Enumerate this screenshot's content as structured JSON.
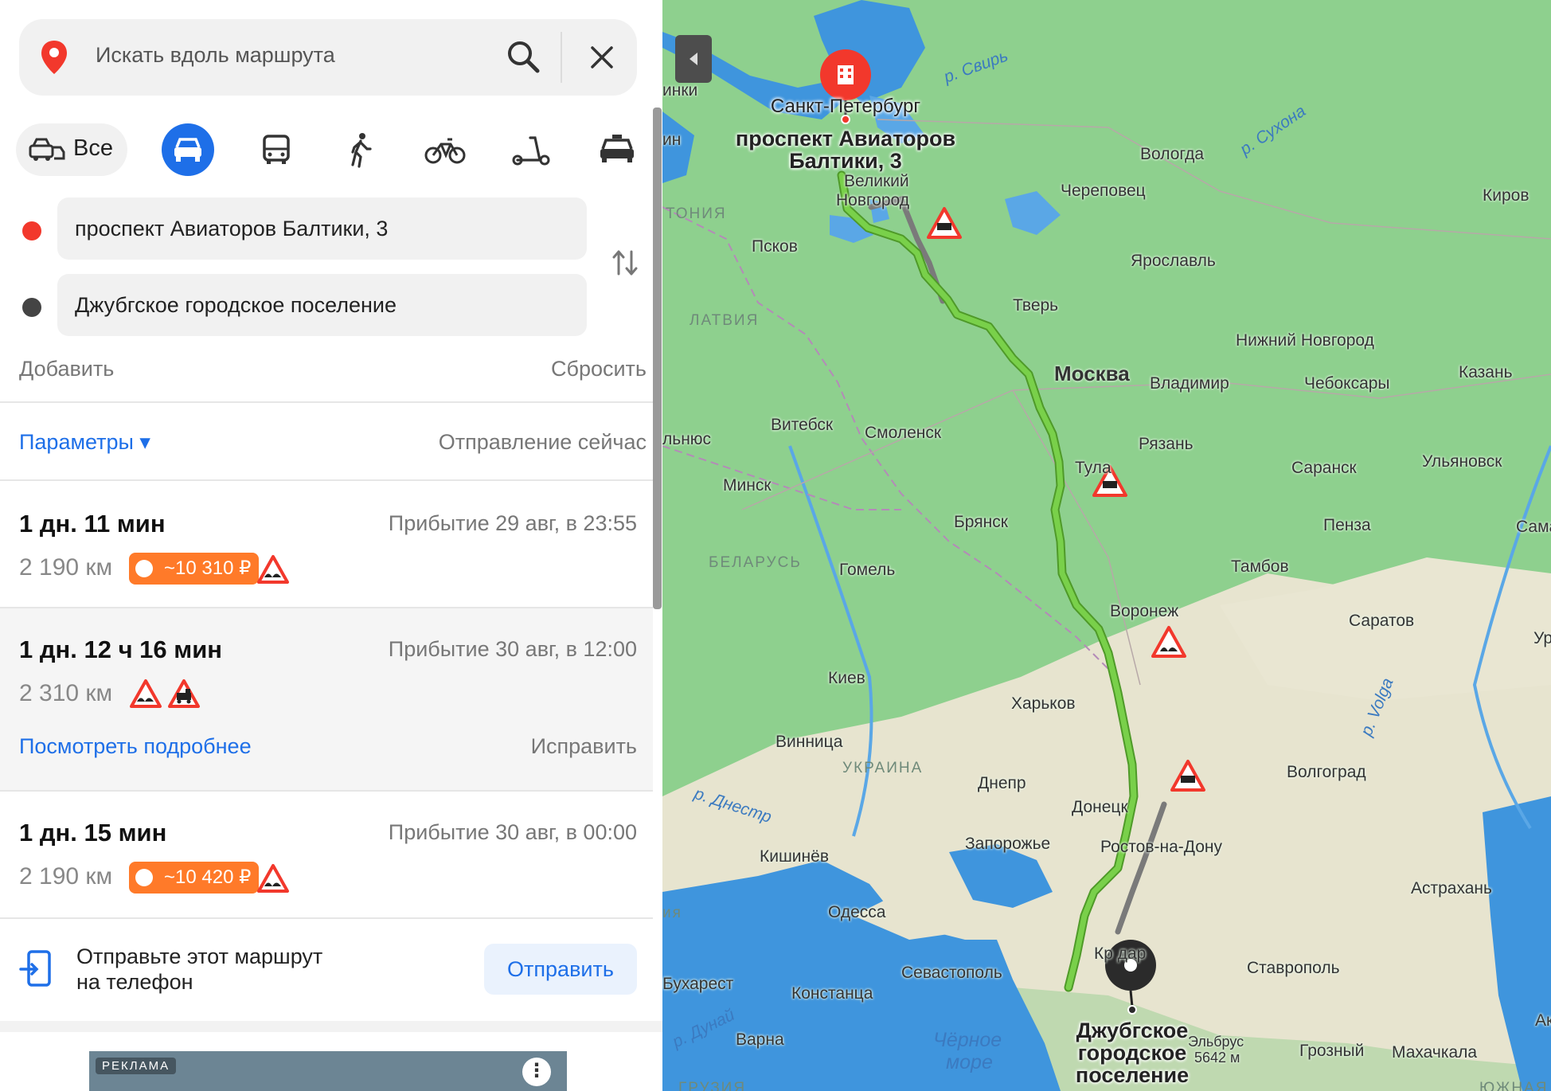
{
  "search": {
    "placeholder": "Искать вдоль маршрута"
  },
  "modes": {
    "all_label": "Все"
  },
  "route_points": {
    "from": "проспект Авиаторов Балтики, 3",
    "to": "Джубгское городское поселение"
  },
  "actions": {
    "add": "Добавить",
    "reset": "Сбросить"
  },
  "params": {
    "label": "Параметры ▾",
    "departure": "Отправление сейчас"
  },
  "routes": [
    {
      "time": "1 дн. 11 мин",
      "arrival": "Прибытие 29 авг, в 23:55",
      "distance": "2 190 км",
      "toll": "~10 310 ₽"
    },
    {
      "time": "1 дн. 12 ч 16 мин",
      "arrival": "Прибытие 30 авг, в 12:00",
      "distance": "2 310 км",
      "details": "Посмотреть подробнее",
      "fix": "Исправить"
    },
    {
      "time": "1 дн. 15 мин",
      "arrival": "Прибытие 30 авг, в 00:00",
      "distance": "2 190 км",
      "toll": "~10 420 ₽"
    }
  ],
  "send": {
    "text_line1": "Отправьте этот маршрут",
    "text_line2": "на телефон",
    "button": "Отправить"
  },
  "ad": {
    "label": "РЕКЛАМА"
  },
  "map": {
    "start_label_1": "Санкт-Петербург",
    "start_label_2": "проспект Авиаторов",
    "start_label_3": "Балтики, 3",
    "end_label_1": "Джубгское",
    "end_label_2": "городское",
    "end_label_3": "поселение",
    "cities": {
      "vnovgorod1": "Великий",
      "vnovgorod2": "Новгород",
      "pskov": "Псков",
      "tver": "Тверь",
      "moscow": "Москва",
      "vologda": "Вологда",
      "cherepovets": "Череповец",
      "yaroslavl": "Ярославль",
      "kirov": "Киров",
      "nnovgorod": "Нижний Новгород",
      "vladimir": "Владимир",
      "cheboksary": "Чебоксары",
      "kazan": "Казань",
      "vitebsk": "Витебск",
      "smolensk": "Смоленск",
      "minsk": "Минск",
      "bryansk": "Брянск",
      "tula": "Тула",
      "ryazan": "Рязань",
      "saransk": "Саранск",
      "ulyanovsk": "Ульяновск",
      "penza": "Пенза",
      "samara": "Самара",
      "gomel": "Гомель",
      "tambov": "Тамбов",
      "voronezh": "Воронеж",
      "saratov": "Саратов",
      "kiev": "Киев",
      "kharkov": "Харьков",
      "vinnitsa": "Винница",
      "dnepr": "Днепр",
      "donetsk": "Донецк",
      "volgograd": "Волгоград",
      "zaporozhye": "Запорожье",
      "rostov": "Ростов-на-Дону",
      "kishinev": "Кишинёв",
      "odessa": "Одесса",
      "astrakhan": "Астрахань",
      "sevastopol": "Севастополь",
      "krasnodar": "Кр    дар",
      "stavropol": "Ставрополь",
      "bucharest": "Бухарест",
      "constanta": "Констанца",
      "varna": "Варна",
      "grozny": "Грозный",
      "makhachkala": "Махачкала",
      "elbrus": "Эльбрус",
      "elbrus_h": "5642 м",
      "inki": "инки",
      "in": "ин",
      "lnyus": "льнюс",
      "ia": "ия",
      "ur": "Ур",
      "ak": "Ак"
    },
    "countries": {
      "estonia": "ТОНИЯ",
      "latvia": "ЛАТВИЯ",
      "belarus": "БЕЛАРУСЬ",
      "ukraine": "УКРАИНА",
      "georgia": "ГРУЗИЯ",
      "south": "ЮЖНАЯ"
    },
    "water": {
      "svir": "р. Свирь",
      "sukhona": "р. Сухона",
      "dnestr": "р. Днестр",
      "dunai": "р. Дунай",
      "volga": "р. Volga",
      "black_sea_1": "Чёрное",
      "black_sea_2": "море"
    }
  },
  "colors": {
    "accent": "#1e6fe8",
    "toll": "#ff7a29",
    "route": "#6cc13f",
    "start_pin": "#f2382c",
    "end_pin": "#2b2b2b"
  }
}
